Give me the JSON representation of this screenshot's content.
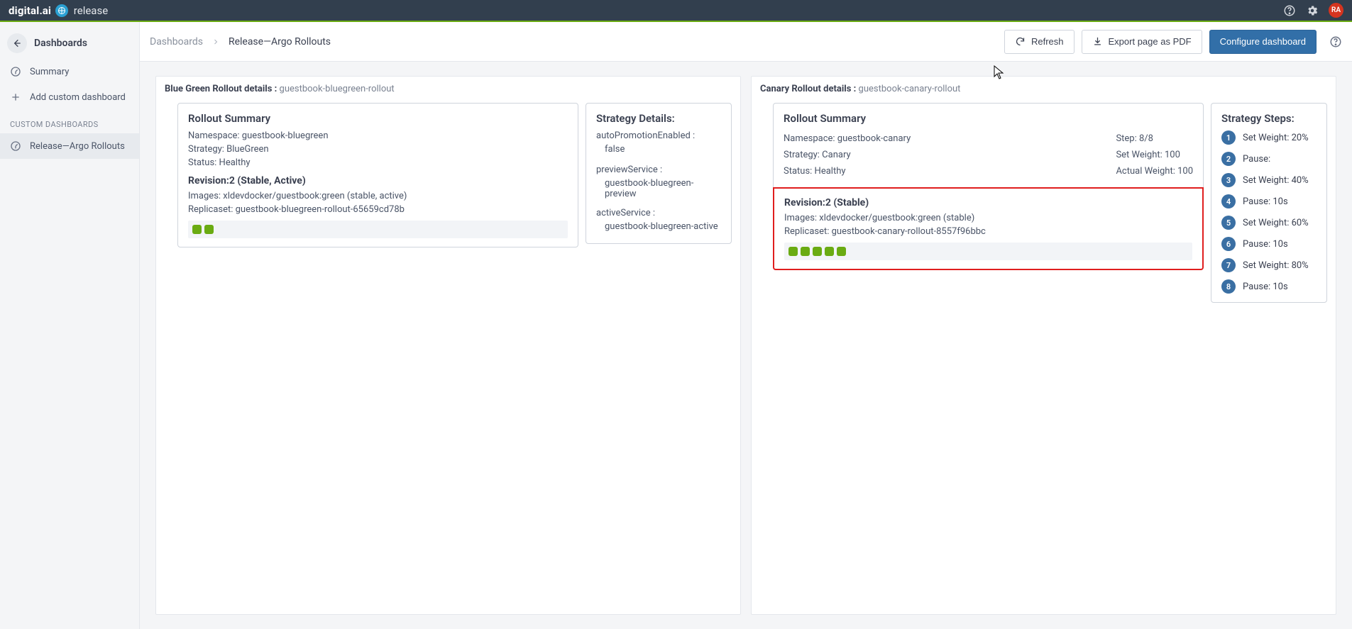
{
  "brand": {
    "primary": "digital",
    "ai_suffix": ".ai",
    "product": "release"
  },
  "avatar": "RA",
  "sidebar": {
    "title": "Dashboards",
    "items": [
      {
        "label": "Summary"
      },
      {
        "label": "Add custom dashboard"
      }
    ],
    "section_label": "CUSTOM DASHBOARDS",
    "custom": [
      {
        "label": "Release—Argo Rollouts"
      }
    ]
  },
  "breadcrumb": {
    "root": "Dashboards",
    "current": "Release—Argo Rollouts"
  },
  "header_buttons": {
    "refresh": "Refresh",
    "export": "Export page as PDF",
    "configure": "Configure dashboard"
  },
  "bluegreen": {
    "panel_title_prefix": "Blue Green Rollout details : ",
    "panel_title_name": "guestbook-bluegreen-rollout",
    "summary_title": "Rollout Summary",
    "namespace": "Namespace: guestbook-bluegreen",
    "strategy": "Strategy: BlueGreen",
    "status": "Status: Healthy",
    "revision_title": "Revision:2 (Stable, Active)",
    "images": "Images: xldevdocker/guestbook:green (stable, active)",
    "replicaset": "Replicaset: guestbook-bluegreen-rollout-65659cd78b",
    "pods": 2,
    "strategy_details_title": "Strategy Details:",
    "auto_promo_label": "autoPromotionEnabled :",
    "auto_promo_value": "false",
    "preview_label": "previewService :",
    "preview_value": "guestbook-bluegreen-preview",
    "active_label": "activeService :",
    "active_value": "guestbook-bluegreen-active"
  },
  "canary": {
    "panel_title_prefix": "Canary Rollout details : ",
    "panel_title_name": "guestbook-canary-rollout",
    "summary_title": "Rollout Summary",
    "namespace": "Namespace: guestbook-canary",
    "strategy": "Strategy: Canary",
    "status": "Status: Healthy",
    "step": "Step: 8/8",
    "set_weight": "Set Weight: 100",
    "actual_weight": "Actual Weight: 100",
    "revision_title": "Revision:2 (Stable)",
    "images": "Images: xldevdocker/guestbook:green (stable)",
    "replicaset": "Replicaset: guestbook-canary-rollout-8557f96bbc",
    "pods": 5,
    "strategy_steps_title": "Strategy Steps:",
    "steps": [
      "Set Weight: 20%",
      "Pause:",
      "Set Weight: 40%",
      "Pause: 10s",
      "Set Weight: 60%",
      "Pause: 10s",
      "Set Weight: 80%",
      "Pause: 10s"
    ]
  }
}
